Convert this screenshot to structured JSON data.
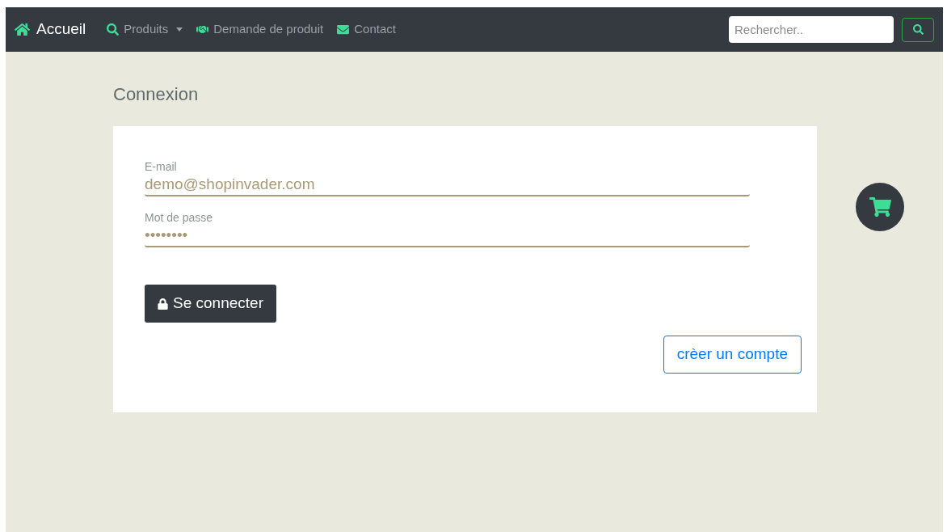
{
  "navbar": {
    "brand": "Accueil",
    "items": [
      {
        "label": "Produits",
        "kind": "dropdown"
      },
      {
        "label": "Demande de produit",
        "kind": "link"
      },
      {
        "label": "Contact",
        "kind": "link"
      }
    ],
    "search": {
      "placeholder": "Rechercher.."
    }
  },
  "page_title": "Connexion",
  "form": {
    "fields": [
      {
        "label": "E-mail",
        "value": "demo@shopinvader.com"
      },
      {
        "label": "Mot de passe",
        "value": "••••••••"
      }
    ],
    "submit": "Se connecter",
    "create_account": "crèer un compte"
  }
}
